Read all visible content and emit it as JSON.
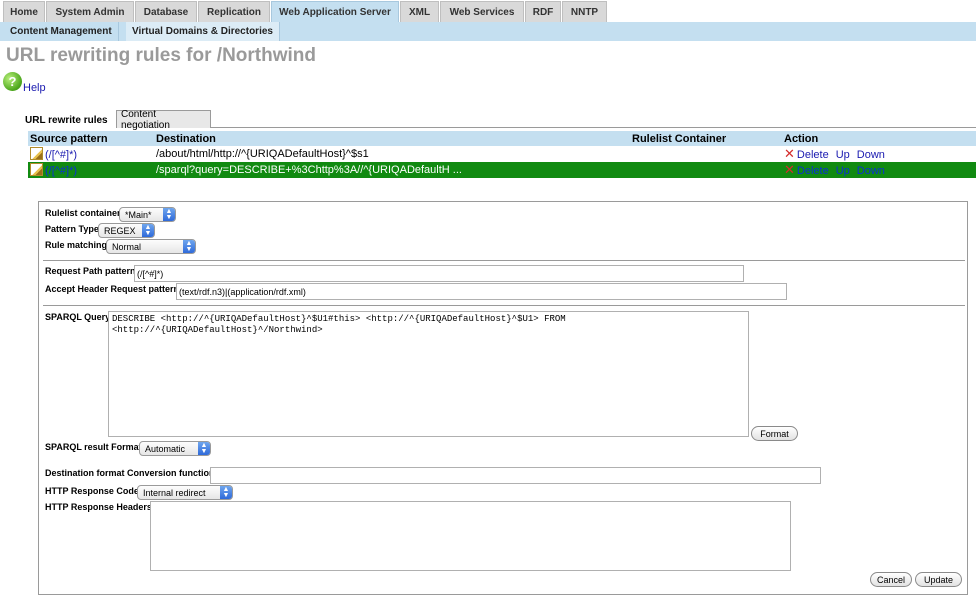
{
  "nav": {
    "main_tabs": [
      "Home",
      "System Admin",
      "Database",
      "Replication",
      "Web Application Server",
      "XML",
      "Web Services",
      "RDF",
      "NNTP"
    ],
    "sub_tabs": [
      "Content Management",
      "Virtual Domains & Directories"
    ]
  },
  "page": {
    "title": "URL rewriting rules for /Northwind",
    "help_label": "Help"
  },
  "inner_tabs": [
    "URL rewrite rules",
    "Content negotiation"
  ],
  "rules_table": {
    "columns": [
      "Source pattern",
      "Destination",
      "Rulelist Container",
      "Action"
    ],
    "rows": [
      {
        "source": "(/[^#]*)",
        "destination": "/about/html/http://^{URIQADefaultHost}^$s1",
        "container": "",
        "actions": [
          "Delete",
          "Up",
          "Down"
        ]
      },
      {
        "source": "(/[^#]*)",
        "destination": "/sparql?query=DESCRIBE+%3Chttp%3A//^{URIQADefaultH ...",
        "container": "",
        "actions": [
          "Delete",
          "Up",
          "Down"
        ]
      }
    ]
  },
  "form": {
    "rulelist_container": {
      "label": "Rulelist container",
      "value": "*Main*"
    },
    "pattern_type": {
      "label": "Pattern Type",
      "value": "REGEX"
    },
    "rule_matching": {
      "label": "Rule matching",
      "value": "Normal"
    },
    "request_path_pattern": {
      "label": "Request Path pattern",
      "value": "(/[^#]*)"
    },
    "accept_header_pattern": {
      "label": "Accept Header Request pattern",
      "value": "(text/rdf.n3)|(application/rdf.xml)"
    },
    "sparql_query": {
      "label": "SPARQL Query",
      "value": "DESCRIBE <http://^{URIQADefaultHost}^$U1#this> <http://^{URIQADefaultHost}^$U1> FROM\n<http://^{URIQADefaultHost}^/Northwind>"
    },
    "format_button": "Format",
    "sparql_result_format": {
      "label": "SPARQL result Format",
      "value": "Automatic"
    },
    "destination_conversion": {
      "label": "Destination format Conversion function",
      "value": ""
    },
    "http_response_code": {
      "label": "HTTP Response Code",
      "value": "Internal redirect"
    },
    "http_response_headers": {
      "label": "HTTP Response Headers",
      "value": ""
    },
    "cancel_button": "Cancel",
    "update_button": "Update"
  },
  "colors": {
    "tab_bar": "#c4dff0",
    "selected_row": "#118a11",
    "title_gray": "#9a9a9a",
    "delete_red": "#d42c2c"
  },
  "icons": [
    "help-icon",
    "edit-icon",
    "delete-icon",
    "select-arrow-icon"
  ]
}
